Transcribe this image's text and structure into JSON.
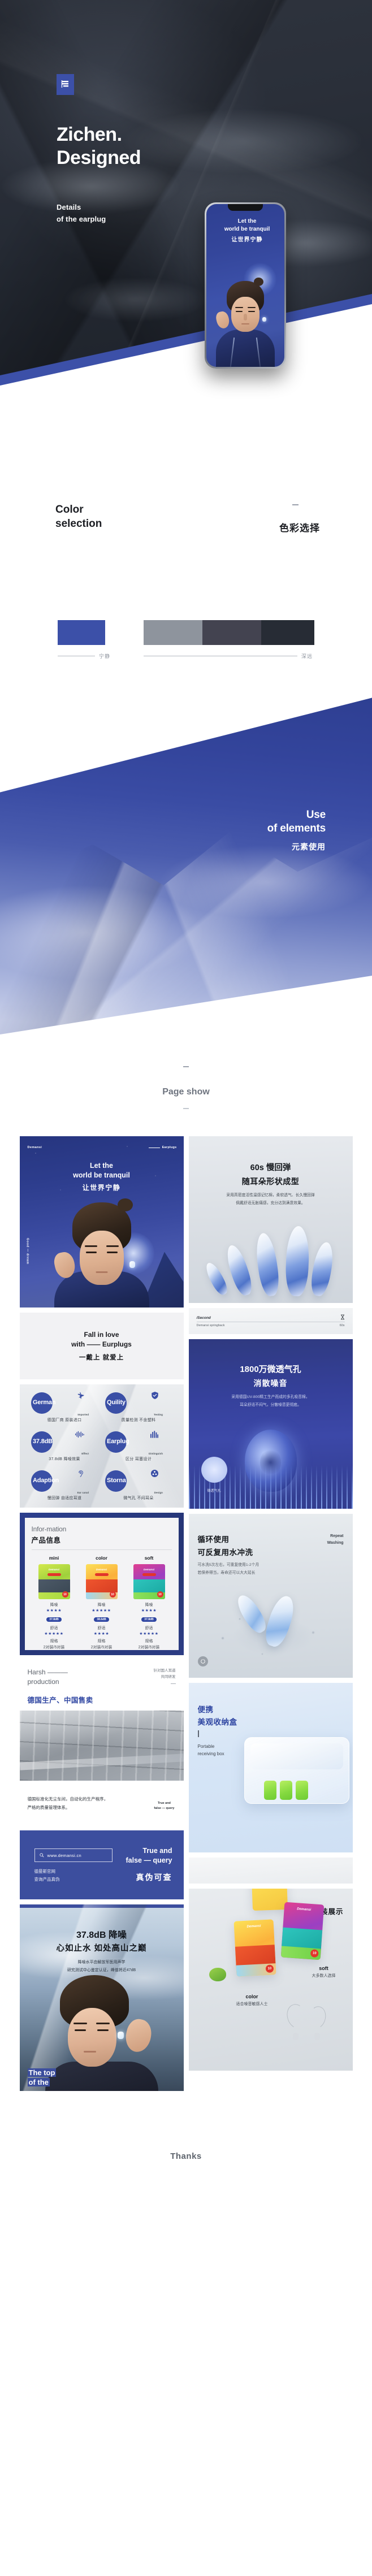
{
  "hero": {
    "logo_icon": "document-lines-icon",
    "title_line1": "Zichen.",
    "title_line2": "Designed",
    "sub_line1": "Details",
    "sub_line2": "of the earplug",
    "phone": {
      "headline_l1": "Let the",
      "headline_l2": "world be tranquil",
      "headline_cn": "让世界宁静"
    }
  },
  "color_selection": {
    "heading_en_l1": "Color",
    "heading_en_l2": "selection",
    "heading_cn": "色彩选择",
    "swatches": [
      {
        "name": "tranquil-blue",
        "hex": "#3c50a8"
      },
      {
        "name": "mid-grey",
        "hex": "#8e949d"
      },
      {
        "name": "slate",
        "hex": "#434350"
      },
      {
        "name": "charcoal",
        "hex": "#272c35"
      }
    ],
    "label_left": "宁静",
    "label_right": "深远"
  },
  "elements": {
    "heading_en_l1": "Use",
    "heading_en_l2": "of elements",
    "heading_cn": "元素使用"
  },
  "page_show": {
    "title": "Page show"
  },
  "cards": {
    "poster": {
      "tag_left": "Demansi",
      "tag_right": "Earplugs",
      "side_label": "Good — dream",
      "headline_l1": "Let the",
      "headline_l2": "world be tranquil",
      "headline_cn": "让世界宁静"
    },
    "fall_in_love": {
      "line1": "Fall in love",
      "line2": "with —— Eurplugs",
      "line_cn": "一戴上 就爱上"
    },
    "badges": [
      {
        "word": "German",
        "en": "Imported",
        "cn": "德国厂商 原装进口",
        "icon": "airplane-icon"
      },
      {
        "word": "Quility",
        "en": "Testing",
        "cn": "质量检测 不含塑料",
        "icon": "shield-check-icon"
      },
      {
        "word": "37.8dB",
        "en": "Effect",
        "cn": "37.8dB 降噪效果",
        "icon": "waveform-icon"
      },
      {
        "word": "Earplug",
        "en": "Distinguish",
        "cn": "区分 耳塞设计",
        "icon": "bars-icon"
      },
      {
        "word": "Adaption",
        "en": "Ear canal",
        "cn": "慢回弹 自适应耳道",
        "icon": "ear-icon"
      },
      {
        "word": "Storna",
        "en": "Design",
        "cn": "微气孔 不闷耳朵",
        "icon": "vent-icon"
      }
    ],
    "information": {
      "title_en": "Infor-mation",
      "title_cn": "产品信息",
      "columns": [
        {
          "name": "mini",
          "noise_label": "降噪",
          "noise_stars": "★★★★",
          "noise_db": "37.8dB",
          "comfort_label": "舒适",
          "comfort_stars": "★★★★★",
          "spec_label": "规格",
          "spec_value": "2对装/5对装"
        },
        {
          "name": "color",
          "noise_label": "降噪",
          "noise_stars": "★★★★★",
          "noise_db": "38.6dB",
          "comfort_label": "舒适",
          "comfort_stars": "★★★★",
          "spec_label": "规格",
          "spec_value": "2对装/5对装"
        },
        {
          "name": "soft",
          "noise_label": "降噪",
          "noise_stars": "★★★★",
          "noise_db": "37.8dB",
          "comfort_label": "舒适",
          "comfort_stars": "★★★★★",
          "spec_label": "规格",
          "spec_value": "2对装/5对装"
        }
      ]
    },
    "harsh": {
      "en_l1": "Harsh ———",
      "en_l2": "production",
      "cn": "德国生产、中国售卖",
      "side_l1": "针对国人耳道",
      "side_l2": "共同研发"
    },
    "factory_caption": {
      "cn_l1": "德国标准化无尘车间，自动化的生产程序，",
      "cn_l2": "严格的质量管理体系。",
      "side_l1": "True and",
      "side_l2": "false — query"
    },
    "query": {
      "search_value": "www.demansi.cn",
      "search_icon": "search-icon",
      "cn_l1": "德曼斯官网",
      "cn_l2": "查询产品真伪",
      "en_l1": "True and",
      "en_l2": "false — query",
      "cn_big": "真伪可查"
    },
    "db_mountain": {
      "h1": "37.8dB 降噪",
      "h2": "心如止水 如处高山之巅",
      "p_l1": "降噪水平由解放军医用声学",
      "p_l2": "研究测试中心鉴定认证，峰值将近47dB",
      "foot_l1": "The top",
      "foot_l2": "of the"
    },
    "springback": {
      "h1": "60s 慢回弹",
      "h2": "随耳朵形状成型",
      "p_l1": "采用高密度活性温感记忆棉，柔软透气、长久慢回弹",
      "p_l2": "佩戴舒适无胀痛感，充分达到满意效果。"
    },
    "second_strip": {
      "left_top": "/Second",
      "right_top_icon": "hourglass-icon",
      "left_bottom": "Demansi springback",
      "right_bottom": "60s"
    },
    "pores": {
      "h1": "1800万微透气孔",
      "h2": "消散噪音",
      "p_l1": "采用德国UV-800精工生产而成的多孔吸音棉，",
      "p_l2": "耳朵舒适不闷气，分散噪音更彻底。",
      "circle_label": "微透气孔"
    },
    "washing": {
      "h1": "循环使用",
      "h2": "可反复用水冲洗",
      "p_l1": "可水洗5次左右，可重复使用1-2个月",
      "p_l2": "若保养得当，寿命还可以大大延长",
      "side_l1": "Repeat",
      "side_l2": "Washing"
    },
    "box": {
      "h1": "便携",
      "h2": "美观收纳盒",
      "en_l1": "Portable",
      "en_l2": "receiving box"
    },
    "display": {
      "title_cn": "包装展示",
      "soft_en": "soft",
      "soft_cn": "大多数人选择",
      "color_en": "color",
      "color_cn": "适合噪音敏感人士"
    }
  },
  "footer": {
    "thanks": "Thanks"
  }
}
